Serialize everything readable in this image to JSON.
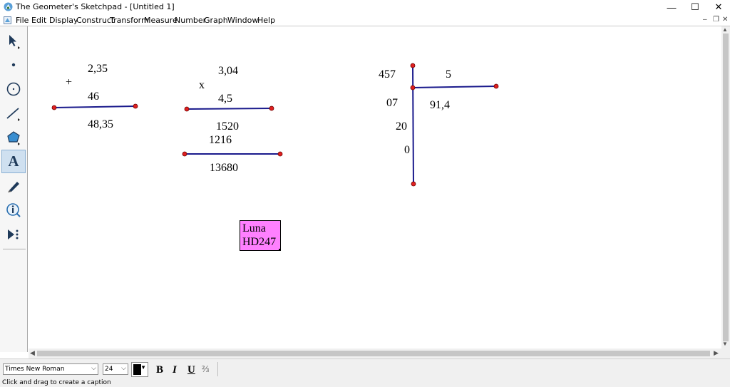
{
  "window": {
    "title": "The Geometer's Sketchpad - [Untitled 1]",
    "minimize": "—",
    "maximize": "☐",
    "close": "✕"
  },
  "menu": {
    "items": [
      "File",
      "Edit",
      "Display",
      "Construct",
      "Transform",
      "Measure",
      "Number",
      "Graph",
      "Window",
      "Help"
    ],
    "mdi_minimize": "–",
    "mdi_restore": "❐",
    "mdi_close": "✕"
  },
  "toolbox": {
    "tools": [
      "arrow-tool",
      "point-tool",
      "compass-tool",
      "straightedge-tool",
      "polygon-tool",
      "text-tool",
      "marker-tool",
      "information-tool",
      "custom-tool"
    ],
    "active_tool": "text-tool",
    "text_tool_glyph": "A"
  },
  "sketch": {
    "addition": {
      "operator": "+",
      "operand1": "2,35",
      "operand2": "46",
      "result": "48,35"
    },
    "multiplication": {
      "operator": "x",
      "operand1": "3,04",
      "operand2": "4,5",
      "partial1": "1520",
      "partial2": "1216",
      "result": "13680"
    },
    "division": {
      "dividend": "457",
      "divisor": "5",
      "quotient": "91,4",
      "remainder1": "07",
      "remainder2": "20",
      "remainder3": "0"
    },
    "caption": {
      "line1": "Luna",
      "line2": "HD247",
      "background": "#ff80ff"
    },
    "segment_color": "#1a1a8c",
    "point_color": "#e02020"
  },
  "formatbar": {
    "font": "Times New Roman",
    "size": "24",
    "bold": "B",
    "italic": "I",
    "underline": "U",
    "math_format": "⅔",
    "text_color": "#000000"
  },
  "status": {
    "text": "Click and drag to create a caption"
  }
}
